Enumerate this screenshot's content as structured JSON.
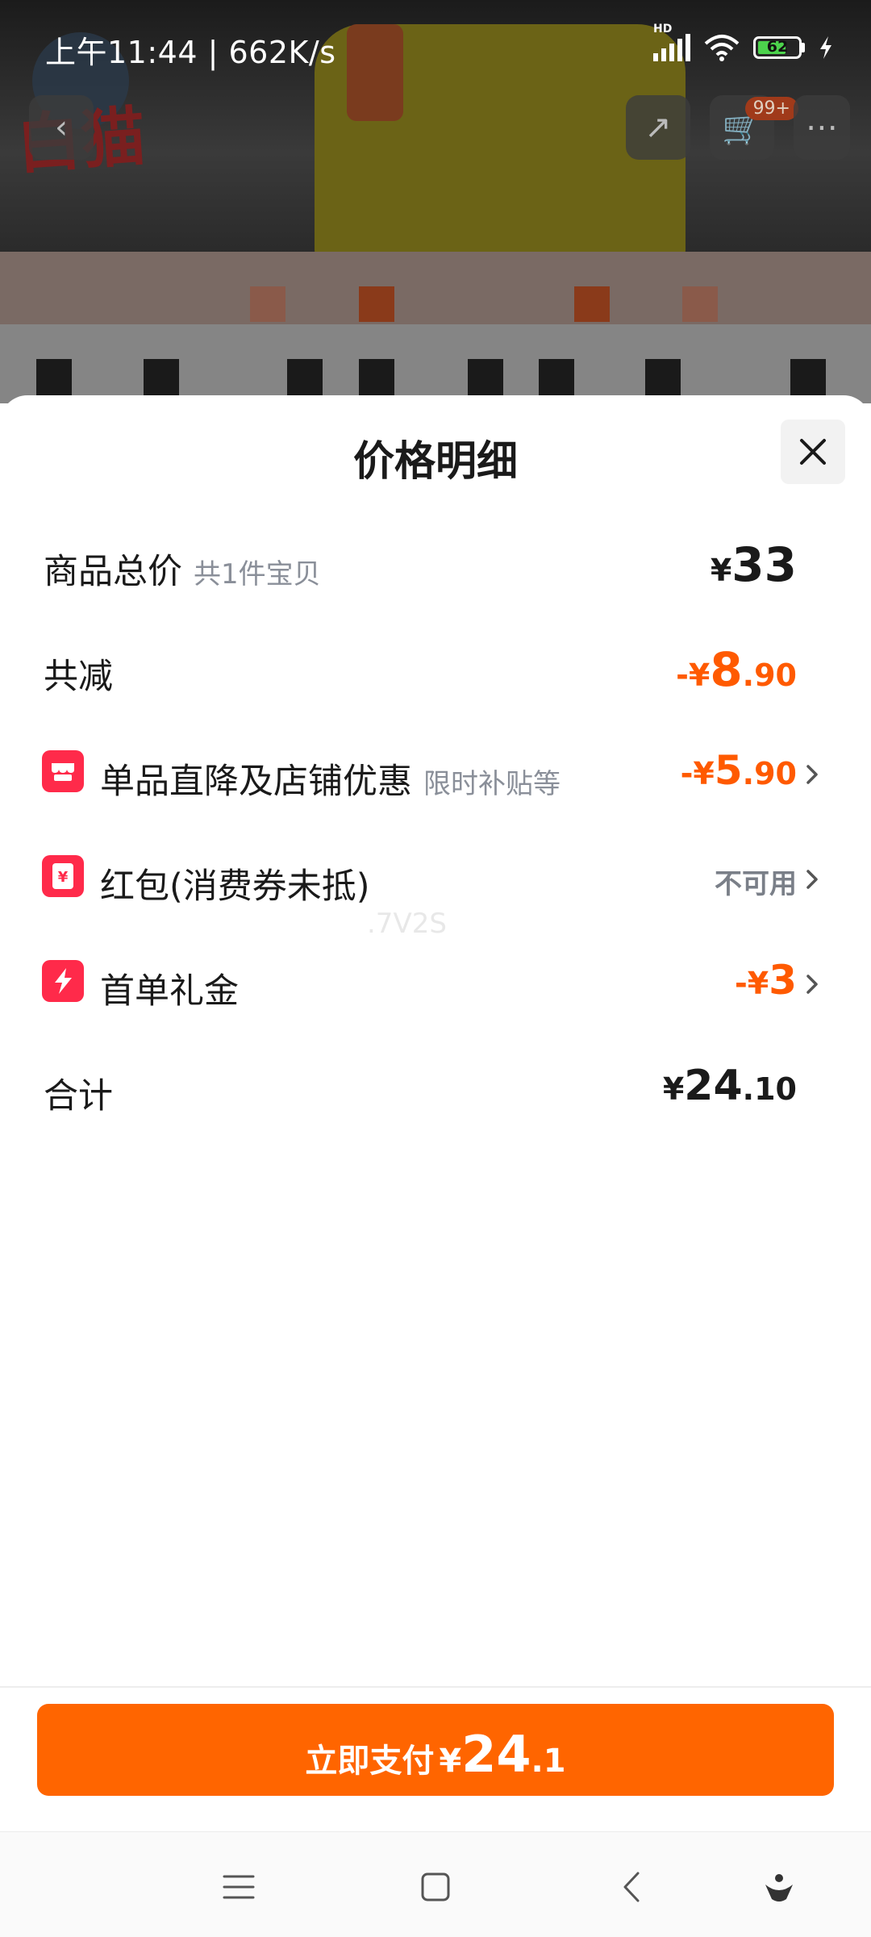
{
  "status_bar": {
    "time": "上午11:44 | 662K/s",
    "network": "HD",
    "battery": "62"
  },
  "background": {
    "brand": "白猫",
    "cart_badge": "99+"
  },
  "sheet": {
    "title": "价格明细",
    "rows": [
      {
        "label": "商品总价",
        "sub": "共1件宝贝",
        "currency": "¥",
        "int": "33",
        "dec": ""
      },
      {
        "label": "共减",
        "currency": "-¥",
        "int": "8",
        "dec": ".90"
      },
      {
        "label": "单品直降及店铺优惠",
        "sub": "限时补贴等",
        "currency": "-¥",
        "int": "5",
        "dec": ".90",
        "icon": "shop-icon"
      },
      {
        "label": "红包(消费券未抵)",
        "value": "不可用",
        "icon": "red-packet-icon"
      },
      {
        "label": "首单礼金",
        "currency": "-¥",
        "int": "3",
        "dec": "",
        "icon": "lightning-icon"
      },
      {
        "label": "合计",
        "currency": "¥",
        "int": "24",
        "dec": ".10"
      }
    ],
    "watermark": ".7V2S"
  },
  "pay_button": {
    "label": "立即支付",
    "currency": "¥",
    "int": "24",
    "dec": ".1"
  },
  "colors": {
    "accent": "#ff6500",
    "discount": "#ff5a00",
    "icon_red": "#ff2a4a"
  }
}
